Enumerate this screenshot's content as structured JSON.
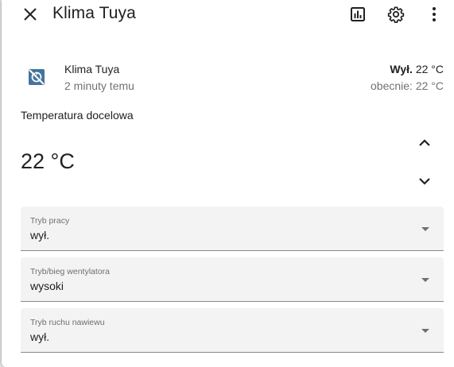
{
  "header": {
    "title": "Klima Tuya",
    "close_icon": "close-icon",
    "history_icon": "chart-box-icon",
    "settings_icon": "gear-icon",
    "menu_icon": "dots-vertical-icon"
  },
  "entity": {
    "name": "Klima Tuya",
    "last_changed": "2 minuty temu",
    "state_label": "Wył.",
    "state_temp": "22 °C",
    "current": "obecnie: 22 °C",
    "icon": "thermostat-off-icon",
    "icon_color": "#44739e"
  },
  "target": {
    "label": "Temperatura docelowa",
    "value": "22 °C"
  },
  "selects": [
    {
      "label": "Tryb pracy",
      "value": "wył."
    },
    {
      "label": "Tryb/bieg wentylatora",
      "value": "wysoki"
    },
    {
      "label": "Tryb ruchu nawiewu",
      "value": "wył."
    }
  ]
}
